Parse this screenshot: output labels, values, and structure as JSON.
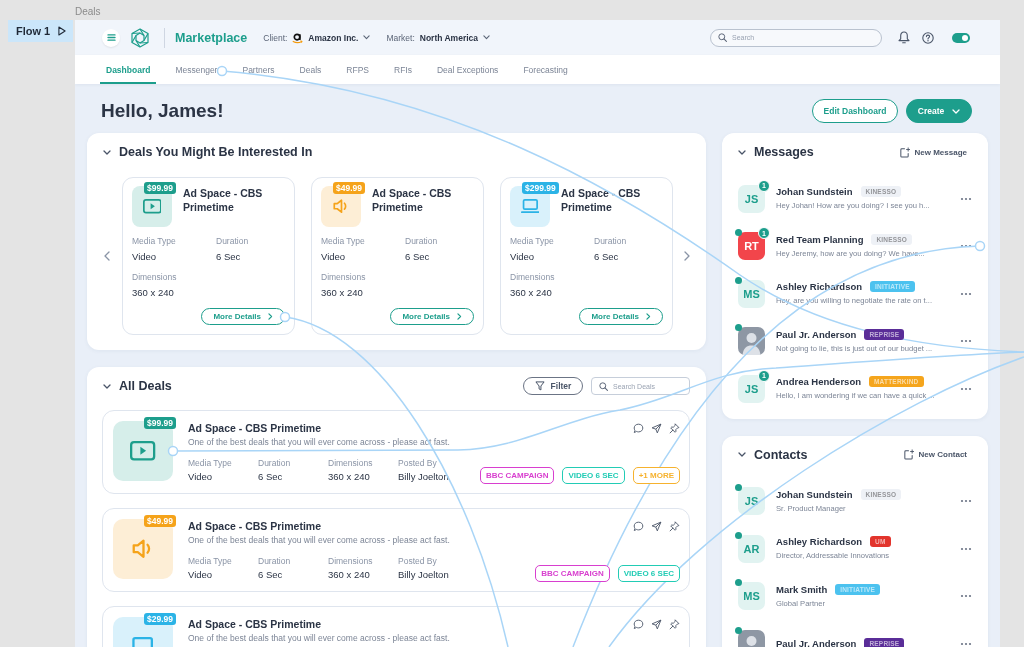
{
  "canvas": {
    "frame_label": "Deals",
    "flow_label": "Flow 1"
  },
  "header": {
    "app_name": "Marketplace",
    "client": {
      "label": "Client:",
      "value": "Amazon Inc."
    },
    "market": {
      "label": "Market:",
      "value": "North America"
    },
    "search": {
      "placeholder": "Search"
    },
    "theme_toggle": {
      "on": true
    }
  },
  "nav_tabs": [
    {
      "label": "Dashboard",
      "selected": true
    },
    {
      "label": "Messenger",
      "selected": false
    },
    {
      "label": "Partners",
      "selected": false
    },
    {
      "label": "Deals",
      "selected": false
    },
    {
      "label": "RFPS",
      "selected": false
    },
    {
      "label": "RFIs",
      "selected": false
    },
    {
      "label": "Deal Exceptions",
      "selected": false
    },
    {
      "label": "Forecasting",
      "selected": false
    }
  ],
  "greeting": "Hello, James!",
  "actions": [
    {
      "label": "Edit Dashboard",
      "kind": "outline"
    },
    {
      "label": "Create",
      "kind": "menu"
    }
  ],
  "suggested_deals": {
    "title": "Deals You Might Be Interested In",
    "expanded": true,
    "cards": [
      {
        "kind": "video",
        "price": "$99.99",
        "color": "#1d9e8c",
        "title": "Ad Space - CBS Primetime",
        "fields": [
          {
            "label": "Media Type",
            "value": "Video"
          },
          {
            "label": "Duration",
            "value": "6 Sec"
          },
          {
            "label": "Dimensions",
            "value": "360 x 240"
          }
        ],
        "button": "More Details"
      },
      {
        "kind": "audio",
        "price": "$49.99",
        "color": "#f5a31a",
        "title": "Ad Space - CBS Primetime",
        "fields": [
          {
            "label": "Media Type",
            "value": "Video"
          },
          {
            "label": "Duration",
            "value": "6 Sec"
          },
          {
            "label": "Dimensions",
            "value": "360 x 240"
          }
        ],
        "button": "More Details"
      },
      {
        "kind": "display",
        "price": "$299.99",
        "color": "#2bb3e6",
        "title": "Ad Space - CBS Primetime",
        "fields": [
          {
            "label": "Media Type",
            "value": "Video"
          },
          {
            "label": "Duration",
            "value": "6 Sec"
          },
          {
            "label": "Dimensions",
            "value": "360 x 240"
          }
        ],
        "button": "More Details"
      }
    ]
  },
  "all_deals": {
    "title": "All Deals",
    "expanded": true,
    "filter_button": "Filter",
    "search": {
      "placeholder": "Search Deals"
    },
    "rows": [
      {
        "kind": "video",
        "price": "$99.99",
        "color": "#1d9e8c",
        "title": "Ad Space - CBS Primetime",
        "description": "One of the best deals that you will ever come across - please act fast.",
        "fields": [
          {
            "label": "Media Type",
            "value": "Video"
          },
          {
            "label": "Duration",
            "value": "6 Sec"
          },
          {
            "label": "Dimensions",
            "value": "360 x 240"
          },
          {
            "label": "Posted By",
            "value": "Billy Joelton"
          }
        ],
        "tags": [
          {
            "label": "BBC CAMPAIGN",
            "color": "#d83fcf"
          },
          {
            "label": "VIDEO 6 SEC",
            "color": "#22ccb5"
          },
          {
            "label": "+1 MORE",
            "color": "#f6b22e"
          }
        ]
      },
      {
        "kind": "audio",
        "price": "$49.99",
        "color": "#f5a31a",
        "title": "Ad Space - CBS Primetime",
        "description": "One of the best deals that you will ever come across - please act fast.",
        "fields": [
          {
            "label": "Media Type",
            "value": "Video"
          },
          {
            "label": "Duration",
            "value": "6 Sec"
          },
          {
            "label": "Dimensions",
            "value": "360 x 240"
          },
          {
            "label": "Posted By",
            "value": "Billy Joelton"
          }
        ],
        "tags": [
          {
            "label": "BBC CAMPAIGN",
            "color": "#d83fcf"
          },
          {
            "label": "VIDEO 6 SEC",
            "color": "#22ccb5"
          }
        ]
      },
      {
        "kind": "display",
        "price": "$29.99",
        "color": "#2bb3e6",
        "title": "Ad Space - CBS Primetime",
        "description": "One of the best deals that you will ever come across - please act fast."
      }
    ]
  },
  "messages": {
    "title": "Messages",
    "expanded": true,
    "action": "New Message",
    "items": [
      {
        "name": "Johan Sundstein",
        "tag": {
          "label": "KINESSO",
          "color": "#eef1f6"
        },
        "text": "Hey Johan! How are you doing? I see you h...",
        "avatar": {
          "kind": "initials",
          "initials": "JS",
          "color": "#e1f3f1"
        },
        "unread": "1",
        "online": false
      },
      {
        "name": "Red Team Planning",
        "tag": {
          "label": "KINESSO",
          "color": "#eef1f6"
        },
        "text": "Hey Jeremy, how are you doing? We have...",
        "avatar": {
          "kind": "initials",
          "initials": "RT",
          "color": "#f2454b"
        },
        "unread": "1",
        "online": true
      },
      {
        "name": "Ashley Richardson",
        "tag": {
          "label": "INITIATIVE",
          "color": "#4cc2ef"
        },
        "text": "Hey, are you willing to negotiate the rate on t...",
        "avatar": {
          "kind": "initials",
          "initials": "MS",
          "color": "#e1f3f1"
        },
        "online": true
      },
      {
        "name": "Paul Jr. Anderson",
        "tag": {
          "label": "REPRISE",
          "color": "#5a2d98"
        },
        "text": "Not going to lie, this is just out of our budget ...",
        "avatar": {
          "kind": "photo"
        },
        "online": true
      },
      {
        "name": "Andrea Henderson",
        "tag": {
          "label": "MATTERKIND",
          "color": "#f5a51c"
        },
        "text": "Hello, I am wondering if we can have a quick ...",
        "avatar": {
          "kind": "initials",
          "initials": "JS",
          "color": "#e1f3f1"
        },
        "unread": "1",
        "online": false
      }
    ]
  },
  "contacts": {
    "title": "Contacts",
    "expanded": true,
    "action": "New Contact",
    "items": [
      {
        "name": "Johan Sundstein",
        "tag": {
          "label": "KINESSO",
          "color": "#eef1f6"
        },
        "text": "Sr. Product Manager",
        "avatar": {
          "kind": "initials",
          "initials": "JS",
          "color": "#e1f3f1"
        },
        "online": true
      },
      {
        "name": "Ashley Richardson",
        "tag": {
          "label": "UM",
          "color": "#e2342c"
        },
        "text": "Director, Addressable Innovations",
        "avatar": {
          "kind": "initials",
          "initials": "AR",
          "color": "#e1f3f1"
        },
        "online": true
      },
      {
        "name": "Mark Smith",
        "tag": {
          "label": "INITIATIVE",
          "color": "#4cc2ef"
        },
        "text": "Global Partner",
        "avatar": {
          "kind": "initials",
          "initials": "MS",
          "color": "#e1f3f1"
        },
        "online": true
      },
      {
        "name": "Paul Jr. Anderson",
        "tag": {
          "label": "REPRISE",
          "color": "#5a2d98"
        },
        "avatar": {
          "kind": "photo"
        },
        "online": true
      }
    ]
  }
}
